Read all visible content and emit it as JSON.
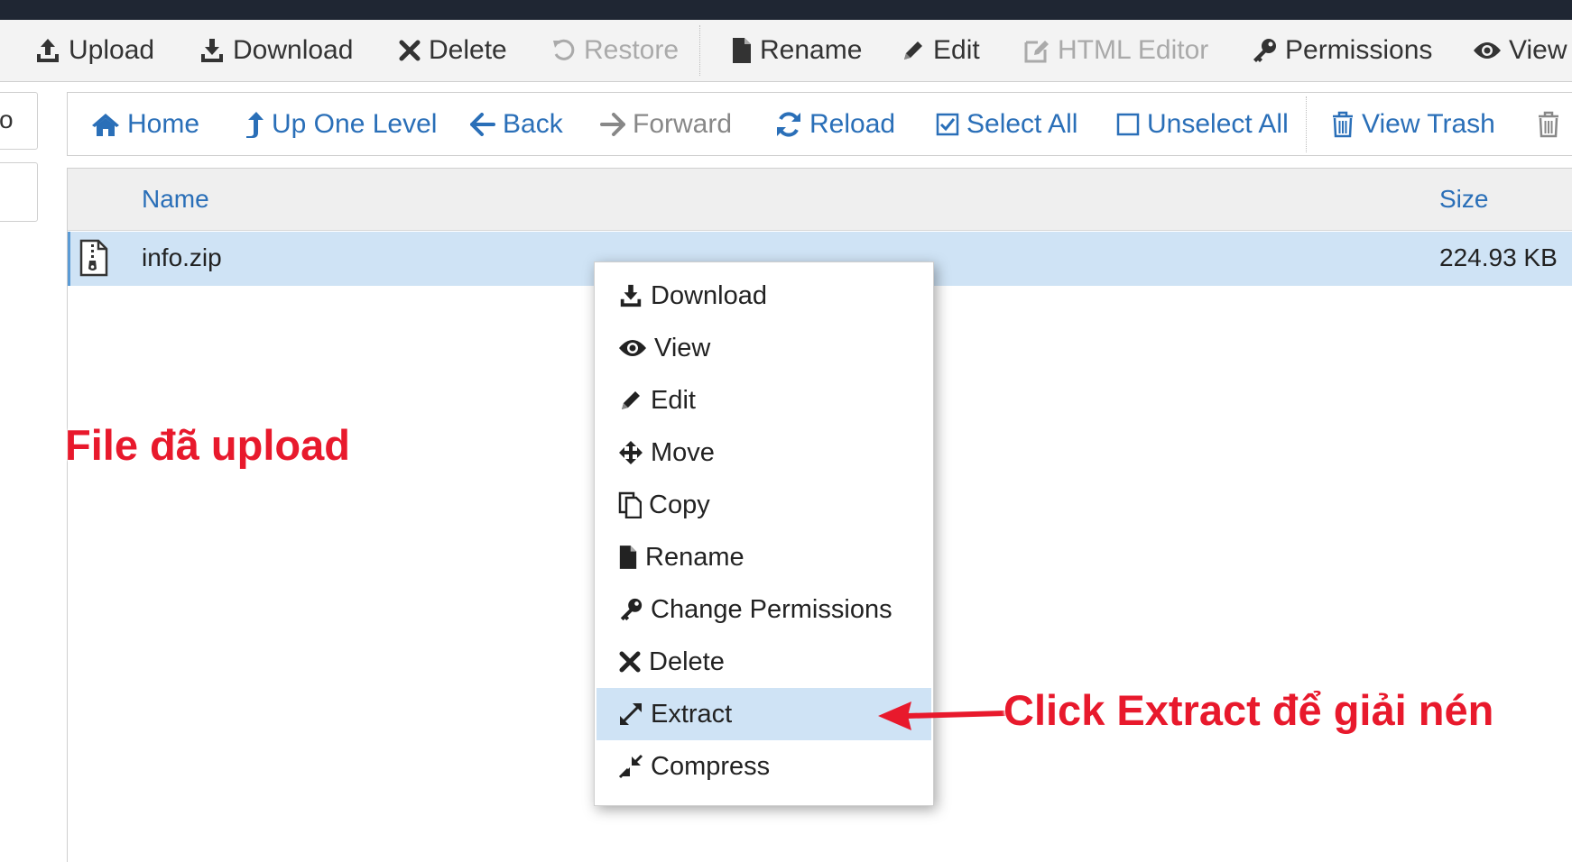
{
  "toolbar": {
    "upload": "Upload",
    "download": "Download",
    "delete": "Delete",
    "restore": "Restore",
    "rename": "Rename",
    "edit": "Edit",
    "html_editor": "HTML Editor",
    "permissions": "Permissions",
    "view": "View"
  },
  "left_stub": {
    "label": "o"
  },
  "nav": {
    "home": "Home",
    "up_one_level": "Up One Level",
    "back": "Back",
    "forward": "Forward",
    "reload": "Reload",
    "select_all": "Select All",
    "unselect_all": "Unselect All",
    "view_trash": "View Trash"
  },
  "table": {
    "columns": {
      "name": "Name",
      "size": "Size"
    },
    "rows": [
      {
        "name": "info.zip",
        "size": "224.93 KB",
        "icon": "zip-file-icon",
        "selected": true
      }
    ]
  },
  "context_menu": {
    "items": [
      {
        "label": "Download",
        "icon": "download-icon"
      },
      {
        "label": "View",
        "icon": "eye-icon"
      },
      {
        "label": "Edit",
        "icon": "pencil-icon"
      },
      {
        "label": "Move",
        "icon": "move-icon"
      },
      {
        "label": "Copy",
        "icon": "copy-icon"
      },
      {
        "label": "Rename",
        "icon": "file-icon"
      },
      {
        "label": "Change Permissions",
        "icon": "key-icon"
      },
      {
        "label": "Delete",
        "icon": "x-icon"
      },
      {
        "label": "Extract",
        "icon": "expand-icon",
        "highlighted": true
      },
      {
        "label": "Compress",
        "icon": "compress-icon"
      }
    ]
  },
  "annotations": {
    "file_uploaded": "File đã upload",
    "click_extract": "Click Extract để giải nén"
  },
  "colors": {
    "link_blue": "#2a6fb8",
    "selection_blue": "#cfe3f5",
    "annotation_red": "#e8192c",
    "topbar": "#1f2633"
  }
}
